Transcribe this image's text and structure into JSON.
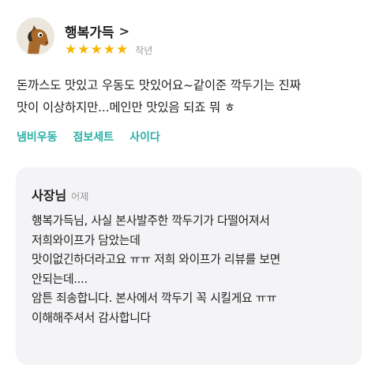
{
  "review": {
    "reviewer_name": "행복가득",
    "chevron": ">",
    "avatar_icon": "horse-avatar-icon",
    "rating": 5,
    "rating_color": "#f7b500",
    "posted": "작년",
    "body_lines": [
      "돈까스도 맛있고 우동도 맛있어요~같이준 깍두기는 진짜",
      "맛이 이상하지만...메인만 맛있음 되죠 뭐 ㅎ"
    ],
    "tags": [
      "냄비우동",
      "점보세트",
      "사이다"
    ],
    "tag_color": "#2ab0a6"
  },
  "reply": {
    "author": "사장님",
    "posted": "어제",
    "lines": [
      "행복가득님, 사실 본사발주한 깍두기가 다떨어져서",
      "저희와이프가 담았는데",
      "맛이없긴하더라고요 ㅠㅠ 저희 와이프가 리뷰를 보면",
      "안되는데....",
      "암튼 죄송합니다. 본사에서 깍두기 꼭 시킬게요 ㅠㅠ",
      "이해해주셔서 감사합니다"
    ]
  }
}
